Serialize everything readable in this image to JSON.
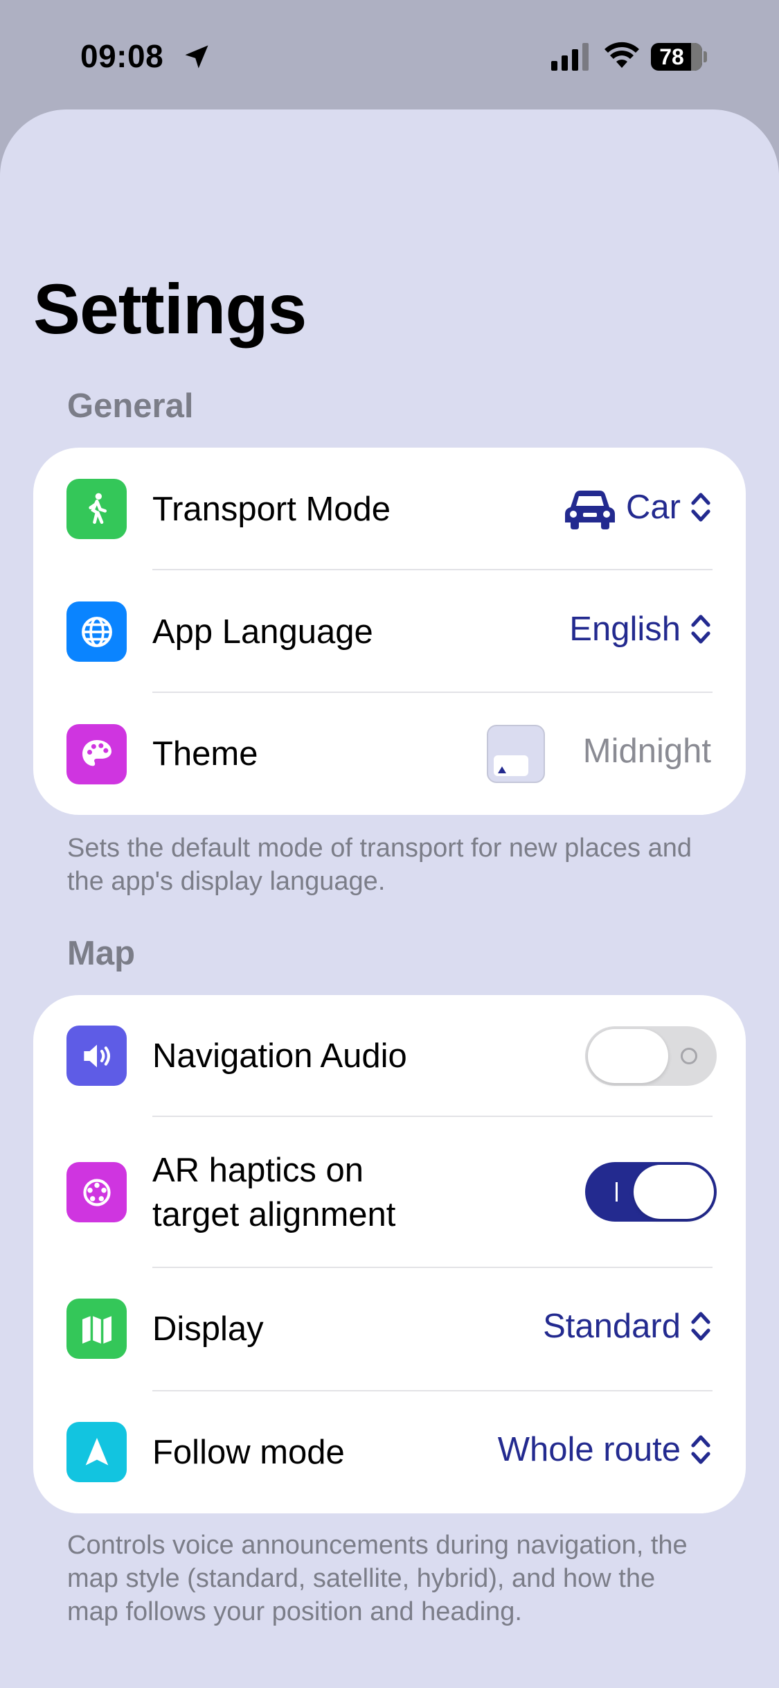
{
  "status_bar": {
    "time": "09:08",
    "battery": "78"
  },
  "title": "Settings",
  "general": {
    "header": "General",
    "transport_mode": {
      "label": "Transport Mode",
      "value": "Car",
      "icon": "figure-walk-icon",
      "icon_color": "#34c759"
    },
    "app_language": {
      "label": "App Language",
      "value": "English",
      "icon": "globe-icon",
      "icon_color": "#0a84ff"
    },
    "theme": {
      "label": "Theme",
      "value": "Midnight",
      "icon": "palette-icon",
      "icon_color": "#cf35e0"
    },
    "footer": "Sets the default mode of transport for new places and the app's display language."
  },
  "map": {
    "header": "Map",
    "navigation_audio": {
      "label": "Navigation Audio",
      "enabled": false,
      "icon": "speaker-icon",
      "icon_color": "#5e5ce6"
    },
    "ar_haptics": {
      "label": "AR haptics on target alignment",
      "label_line1": "AR haptics on",
      "label_line2": "target alignment",
      "enabled": true,
      "icon": "haptics-icon",
      "icon_color": "#cf35e0"
    },
    "display": {
      "label": "Display",
      "value": "Standard",
      "icon": "map-icon",
      "icon_color": "#34c759"
    },
    "follow_mode": {
      "label": "Follow mode",
      "value": "Whole route",
      "icon": "location-arrow-icon",
      "icon_color": "#12c4e0"
    },
    "footer": "Controls voice announcements during navigation, the map style (standard, satellite, hybrid), and how the map follows your position and heading."
  },
  "colors": {
    "accent": "#232a8f",
    "background": "#dadcf0",
    "secondary_text": "#7b7d88"
  }
}
